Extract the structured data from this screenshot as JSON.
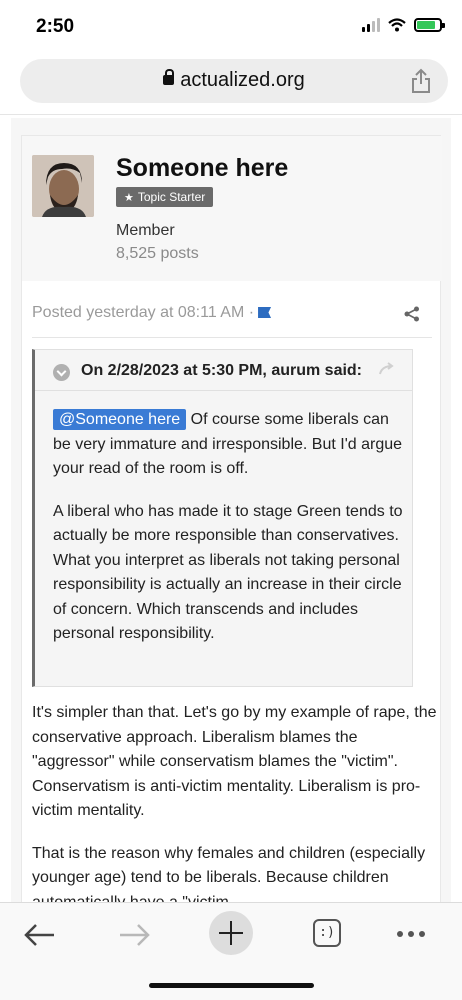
{
  "status_bar": {
    "time": "2:50"
  },
  "browser": {
    "url": "actualized.org"
  },
  "post": {
    "author": {
      "name": "Someone here",
      "badge": "Topic Starter",
      "role": "Member",
      "posts": "8,525 posts"
    },
    "posted": "Posted yesterday at 08:11 AM ·",
    "quote": {
      "citation": "On 2/28/2023 at 5:30 PM, aurum said:",
      "mention": "@Someone here",
      "paragraph1_rest": " Of course some liberals can be very immature and irresponsible. But I'd argue your read of the room is off.",
      "paragraph2": "A liberal who has made it to stage Green tends to actually be more responsible than conservatives.  What you interpret as liberals not taking personal responsibility is actually an increase in their circle of concern. Which transcends and includes personal responsibility."
    },
    "body": [
      "It's simpler than that. Let's go by my example of rape, the conservative approach.  Liberalism blames the \"aggressor\" while conservatism blames the \"victim\". Conservatism is anti-victim mentality. Liberalism is pro-victim mentality.",
      "That is the reason why females and children (especially younger age) tend to be liberals. Because children automatically have a \"victim"
    ]
  },
  "toolbar": {
    "tabs_label": ":)"
  },
  "colors": {
    "accent": "#3a7bd5",
    "flag": "#2d6cc0",
    "battery": "#34c759"
  }
}
